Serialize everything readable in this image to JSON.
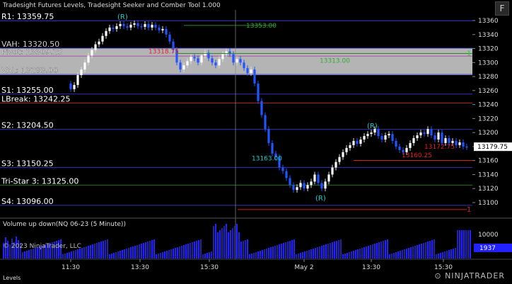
{
  "chart_title": "Tradesight Futures Levels, Tradesight Seeker and Comber Tool 1.000",
  "fullscreen_label": "F",
  "levels": [
    {
      "name": "R1",
      "label": "R1: 13359.75",
      "price": 13359.75,
      "color": "#3a3acd"
    },
    {
      "name": "VAH",
      "label": "VAH: 13320.50",
      "price": 13320.5,
      "color": "#3a3acd"
    },
    {
      "name": "Pivot",
      "label": "Pivot: 13309.25",
      "price": 13309.25,
      "color": "#aa44aa"
    },
    {
      "name": "VAL",
      "label": "VAL: 13283.00",
      "price": 13283.0,
      "color": "#3a3acd"
    },
    {
      "name": "S1",
      "label": "S1: 13255.00",
      "price": 13255.0,
      "color": "#3a3acd"
    },
    {
      "name": "LBreak",
      "label": "LBreak: 13242.25",
      "price": 13242.25,
      "color": "#cc2222"
    },
    {
      "name": "S2",
      "label": "S2: 13204.50",
      "price": 13204.5,
      "color": "#3a3acd"
    },
    {
      "name": "S3",
      "label": "S3: 13150.25",
      "price": 13150.25,
      "color": "#3a3acd"
    },
    {
      "name": "Tri-Star 3",
      "label": "Tri-Star 3: 13125.00",
      "price": 13125.0,
      "color": "#228822"
    },
    {
      "name": "S4",
      "label": "S4: 13096.00",
      "price": 13096.0,
      "color": "#3a3acd"
    }
  ],
  "price_axis": {
    "ticks": [
      13360,
      13340,
      13320,
      13300,
      13280,
      13260,
      13240,
      13220,
      13200,
      13180,
      13160,
      13140,
      13120,
      13100
    ],
    "last_price": "13179.75",
    "min": 13085,
    "max": 13380
  },
  "time_axis": [
    "11:30",
    "13:30",
    "15:30",
    "May 2",
    "13:30",
    "15:30"
  ],
  "chart_annotations": [
    {
      "text": "13353.00",
      "color": "#33aa33",
      "price": 13353
    },
    {
      "text": "13313.00",
      "color": "#33aa33",
      "price": 13313
    },
    {
      "text": "13318.75",
      "color": "#dd2222",
      "price": 13318.75
    },
    {
      "text": "13163.00",
      "color": "#22cccc",
      "price": 13163
    },
    {
      "text": "13160.25",
      "color": "#dd2222",
      "price": 13160.25
    },
    {
      "text": "13172.75",
      "color": "#dd2222",
      "price": 13172.75
    },
    {
      "text": "(R)",
      "color": "#22cccc"
    },
    {
      "text": "(R)",
      "color": "#22cccc"
    },
    {
      "text": "(R)",
      "color": "#22cccc"
    },
    {
      "text": "1",
      "color": "#33cc33"
    },
    {
      "text": "1",
      "color": "#dd2222"
    }
  ],
  "volume_panel": {
    "title": "Volume up down(NQ 06-23 (5 Minute))",
    "axis_label": "10000",
    "last_volume": "1937",
    "up_color": "#2222ff",
    "down_color": "#2222aa"
  },
  "copyright": "© 2023 NinjaTrader, LLC",
  "tab_label": "Levels",
  "logo_text": "NINJATRADER",
  "colors": {
    "background": "#000000",
    "value_area": "#c8c8c8",
    "up_candle": "#ffffff",
    "down_candle": "#2255ff",
    "grid": "#1a1a1a"
  }
}
